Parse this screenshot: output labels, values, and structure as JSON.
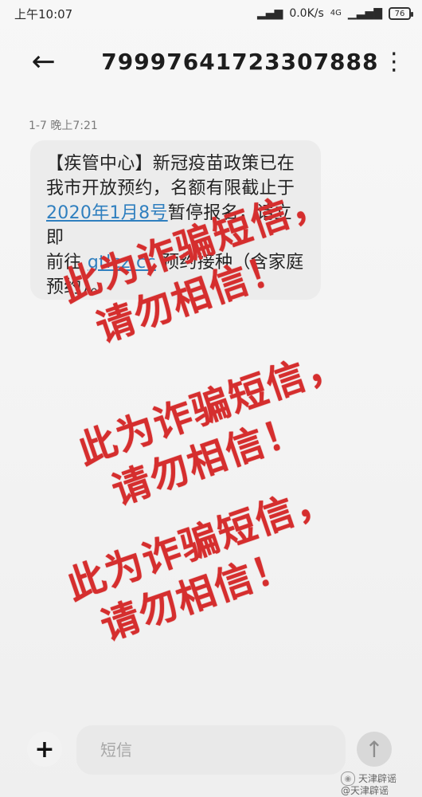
{
  "status_bar": {
    "time": "上午10:07",
    "net_speed": "0.0K/s",
    "network": "4G",
    "battery": "76"
  },
  "header": {
    "back_icon": "back-arrow-icon",
    "phone_number": "79997641723307888",
    "more_icon": "more-vertical-icon"
  },
  "message": {
    "timestamp": "1-7 晚上7:21",
    "line1": "【疾管中心】新冠疫苗政策已在",
    "line2": "我市开放预约，名额有限截止于",
    "line3_link": "2020年1月8号",
    "line3_rest": "暂停报名，请立即",
    "line4_prefix": "前往 ",
    "line4_link": "gtlcz.cc",
    "line4_rest": " 预约接种（含家庭",
    "line5": "预约）。"
  },
  "overlay": {
    "line1": "此为诈骗短信，",
    "line2": "请勿相信！",
    "color": "#d52e2e"
  },
  "compose": {
    "plus_icon": "plus-icon",
    "placeholder": "短信",
    "send_icon": "send-arrow-icon"
  },
  "watermark": {
    "line1": "天津辟谣",
    "line2": "@天津辟谣"
  }
}
